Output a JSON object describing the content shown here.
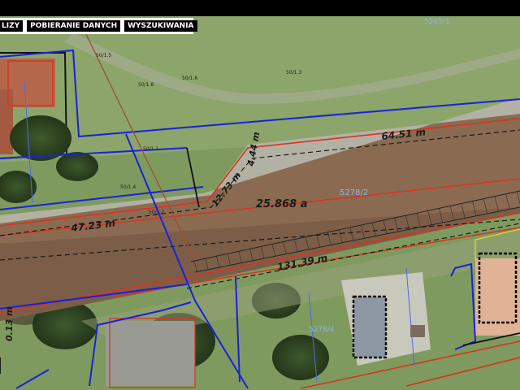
{
  "toolbar": {
    "tabs": [
      {
        "label": "LIZY"
      },
      {
        "label": "POBIERANIE DANYCH"
      },
      {
        "label": "WYSZUKIWANIA"
      }
    ]
  },
  "map": {
    "area_label": "25.868 a",
    "dimensions": {
      "top_edge": "64.51 m",
      "left_edge": "47.23 m",
      "bottom_edge": "131.39 m",
      "diagonal": "12.73 m",
      "corner": "4.44 m",
      "far_left": "0.13 m"
    },
    "parcel_numbers": {
      "main": "5278/2",
      "top_right": "5285/1",
      "bottom": "5278/4"
    },
    "point_labels": {
      "p1": "50/1.5",
      "p2": "50/1.8",
      "p3": "50/1.6",
      "p4": "50/1.3",
      "p5": "50/1.1",
      "p6": "50/1.4",
      "p7": "50/1.2"
    },
    "colors": {
      "owner_boundary": "#1a22d8",
      "parcel_boundary": "#d8341f",
      "building_outline": "#000000",
      "adjacent_boundary": "#e0e020"
    }
  }
}
